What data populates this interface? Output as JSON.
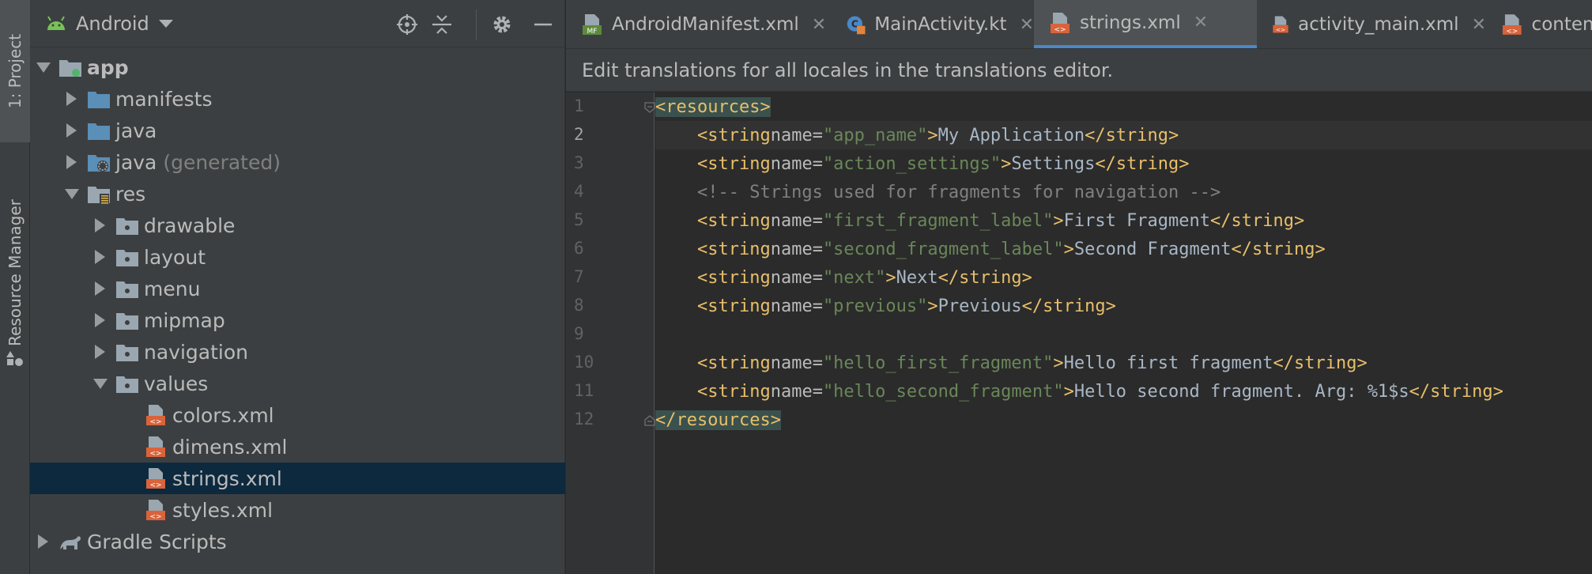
{
  "tool_strip": {
    "project_tab": "1: Project",
    "resource_tab": "Resource Manager"
  },
  "project_panel": {
    "view_mode": "Android",
    "tree": [
      {
        "label": "app",
        "bold": true,
        "expanded": true,
        "depth": 0,
        "icon": "module-icon"
      },
      {
        "label": "manifests",
        "expanded": false,
        "depth": 1,
        "icon": "folder-icon"
      },
      {
        "label": "java",
        "expanded": false,
        "depth": 1,
        "icon": "folder-icon"
      },
      {
        "label": "java",
        "suffix": "(generated)",
        "expanded": false,
        "depth": 1,
        "icon": "generated-folder-icon"
      },
      {
        "label": "res",
        "expanded": true,
        "depth": 1,
        "icon": "res-folder-icon"
      },
      {
        "label": "drawable",
        "expanded": false,
        "depth": 2,
        "icon": "package-folder-icon"
      },
      {
        "label": "layout",
        "expanded": false,
        "depth": 2,
        "icon": "package-folder-icon"
      },
      {
        "label": "menu",
        "expanded": false,
        "depth": 2,
        "icon": "package-folder-icon"
      },
      {
        "label": "mipmap",
        "expanded": false,
        "depth": 2,
        "icon": "package-folder-icon"
      },
      {
        "label": "navigation",
        "expanded": false,
        "depth": 2,
        "icon": "package-folder-icon"
      },
      {
        "label": "values",
        "expanded": true,
        "depth": 2,
        "icon": "package-folder-icon"
      },
      {
        "label": "colors.xml",
        "depth": 3,
        "icon": "xml-file-icon"
      },
      {
        "label": "dimens.xml",
        "depth": 3,
        "icon": "xml-file-icon"
      },
      {
        "label": "strings.xml",
        "depth": 3,
        "icon": "xml-file-icon",
        "selected": true
      },
      {
        "label": "styles.xml",
        "depth": 3,
        "icon": "xml-file-icon"
      },
      {
        "label": "Gradle Scripts",
        "expanded": false,
        "depth": 0,
        "icon": "gradle-icon"
      }
    ]
  },
  "editor": {
    "tabs": [
      {
        "label": "AndroidManifest.xml",
        "icon": "manifest-file-icon",
        "active": false
      },
      {
        "label": "MainActivity.kt",
        "icon": "kotlin-class-icon",
        "active": false
      },
      {
        "label": "strings.xml",
        "icon": "xml-file-icon",
        "active": true
      },
      {
        "label": "activity_main.xml",
        "icon": "xml-file-icon",
        "active": false
      },
      {
        "label": "content_mai",
        "icon": "xml-file-icon",
        "active": false
      }
    ],
    "notice": "Edit translations for all locales in the translations editor.",
    "line_numbers": [
      "1",
      "2",
      "3",
      "4",
      "5",
      "6",
      "7",
      "8",
      "9",
      "10",
      "11",
      "12"
    ],
    "current_line": "2",
    "code": [
      "<resources>",
      "    <string name=\"app_name\">My Application</string>",
      "    <string name=\"action_settings\">Settings</string>",
      "    <!-- Strings used for fragments for navigation -->",
      "    <string name=\"first_fragment_label\">First Fragment</string>",
      "    <string name=\"second_fragment_label\">Second Fragment</string>",
      "    <string name=\"next\">Next</string>",
      "    <string name=\"previous\">Previous</string>",
      "",
      "    <string name=\"hello_first_fragment\">Hello first fragment</string>",
      "    <string name=\"hello_second_fragment\">Hello second fragment. Arg: %1$s</string>",
      "</resources>"
    ]
  },
  "colors": {
    "accent": "#4a88c7",
    "selection": "#0d293e",
    "folder": "#5a8fb8",
    "xml_icon": "#d9633a"
  }
}
